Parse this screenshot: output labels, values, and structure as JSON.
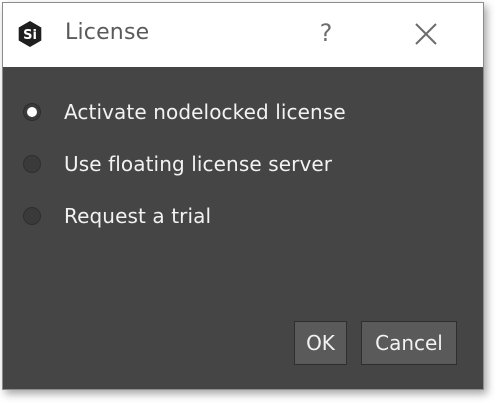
{
  "window": {
    "title": "License",
    "help_glyph": "?",
    "app_icon": "si-logo-icon",
    "close_icon": "close-icon"
  },
  "options": [
    {
      "label": "Activate nodelocked license",
      "selected": true
    },
    {
      "label": "Use floating license server",
      "selected": false
    },
    {
      "label": "Request a trial",
      "selected": false
    }
  ],
  "buttons": {
    "ok_label": "OK",
    "cancel_label": "Cancel"
  },
  "colors": {
    "background": "#454545",
    "titlebar": "#ffffff",
    "button": "#5a5a5a",
    "text": "#f2f2f2"
  }
}
